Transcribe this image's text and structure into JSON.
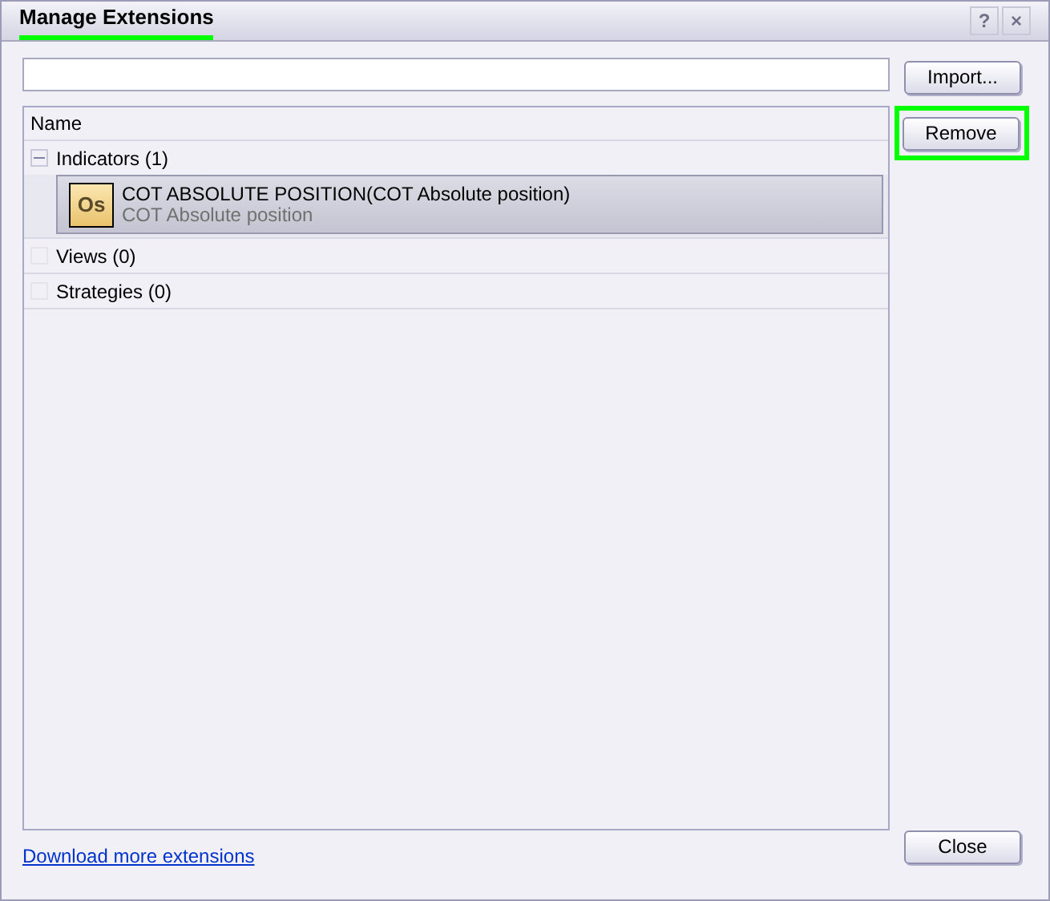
{
  "window": {
    "title": "Manage Extensions",
    "title_highlighted": true,
    "controls": [
      "?",
      "×"
    ]
  },
  "buttons": [
    {
      "label": "Import...",
      "highlighted": false
    },
    {
      "label": "Remove",
      "highlighted": true
    }
  ],
  "list": {
    "columns": [
      "Name"
    ],
    "groups": [
      {
        "label": "Indicators (1)",
        "children": [
          {
            "icon": "Os",
            "title": "COT ABSOLUTE POSITION(COT Absolute position)",
            "subtitle": "COT Absolute position",
            "selected": true
          }
        ]
      },
      {
        "label": "Views (0)"
      },
      {
        "label": "Strategies (0)"
      }
    ]
  },
  "link": "Download more extensions",
  "close_button": "Close"
}
